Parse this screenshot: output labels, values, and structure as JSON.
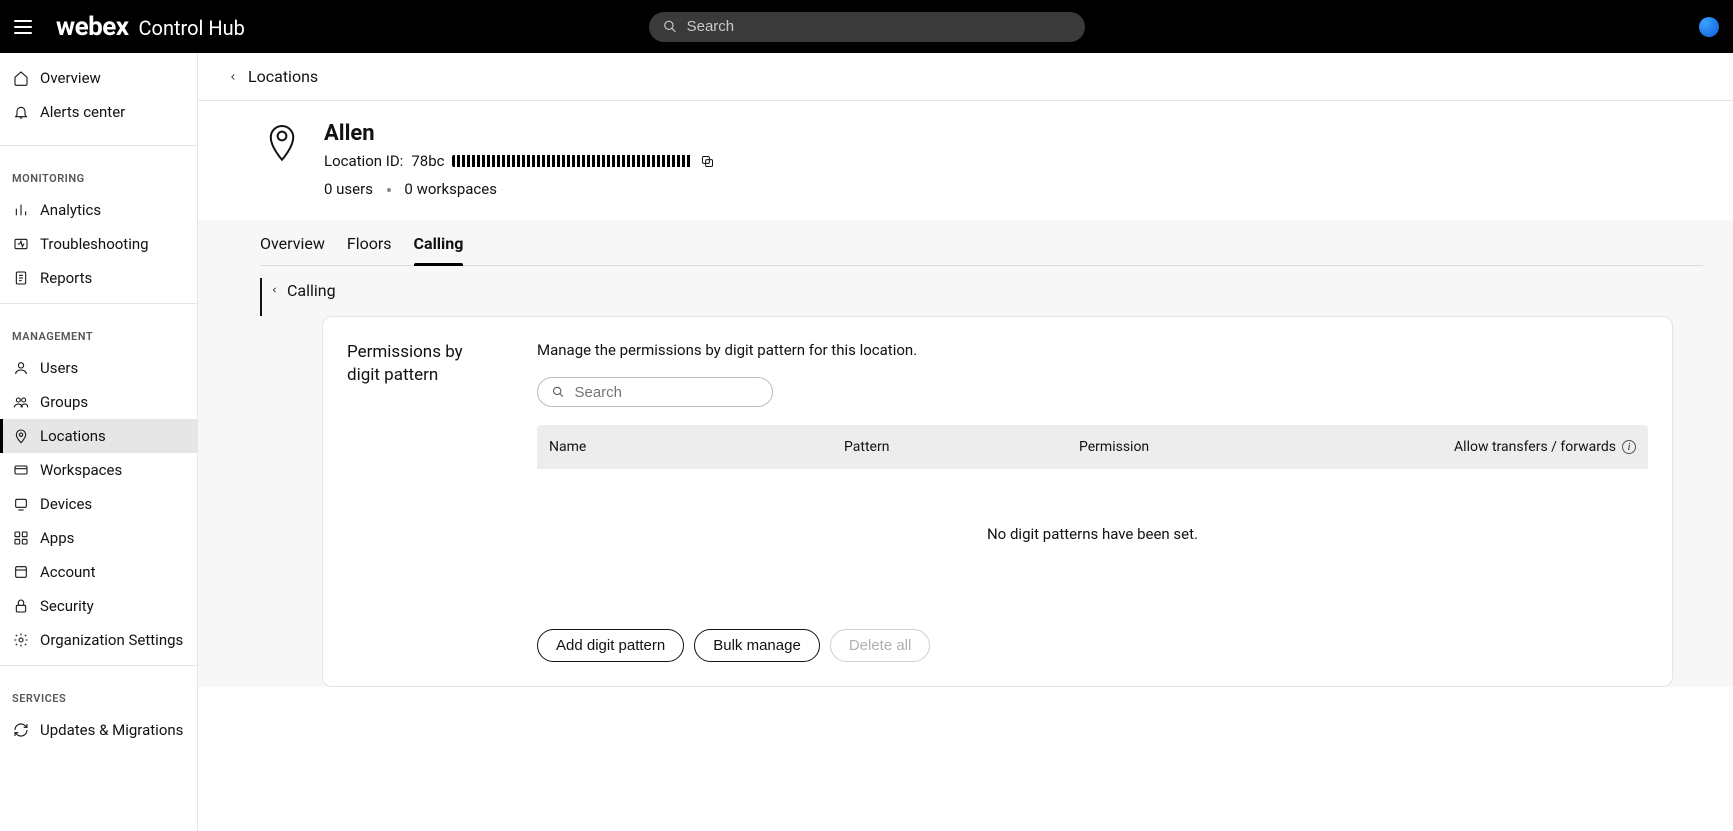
{
  "header": {
    "brand_primary": "webex",
    "brand_secondary": "Control Hub",
    "search_placeholder": "Search"
  },
  "sidebar": {
    "top": [
      {
        "label": "Overview"
      },
      {
        "label": "Alerts center"
      }
    ],
    "monitoring_heading": "MONITORING",
    "monitoring": [
      {
        "label": "Analytics"
      },
      {
        "label": "Troubleshooting"
      },
      {
        "label": "Reports"
      }
    ],
    "management_heading": "MANAGEMENT",
    "management": [
      {
        "label": "Users"
      },
      {
        "label": "Groups"
      },
      {
        "label": "Locations"
      },
      {
        "label": "Workspaces"
      },
      {
        "label": "Devices"
      },
      {
        "label": "Apps"
      },
      {
        "label": "Account"
      },
      {
        "label": "Security"
      },
      {
        "label": "Organization Settings"
      }
    ],
    "services_heading": "SERVICES",
    "services": [
      {
        "label": "Updates & Migrations"
      }
    ]
  },
  "breadcrumb": {
    "label": "Locations"
  },
  "location": {
    "name": "Allen",
    "id_label": "Location ID: ",
    "id_visible_prefix": "78bc",
    "users": "0 users",
    "workspaces": "0 workspaces"
  },
  "tabs": [
    {
      "label": "Overview"
    },
    {
      "label": "Floors"
    },
    {
      "label": "Calling"
    }
  ],
  "sub_breadcrumb": {
    "label": "Calling"
  },
  "panel": {
    "title": "Permissions by digit pattern",
    "description": "Manage the permissions by digit pattern for this location.",
    "search_placeholder": "Search",
    "columns": {
      "name": "Name",
      "pattern": "Pattern",
      "permission": "Permission",
      "allow": "Allow transfers / forwards"
    },
    "empty_message": "No digit patterns have been set.",
    "actions": {
      "add": "Add digit pattern",
      "bulk": "Bulk manage",
      "delete": "Delete all"
    }
  }
}
